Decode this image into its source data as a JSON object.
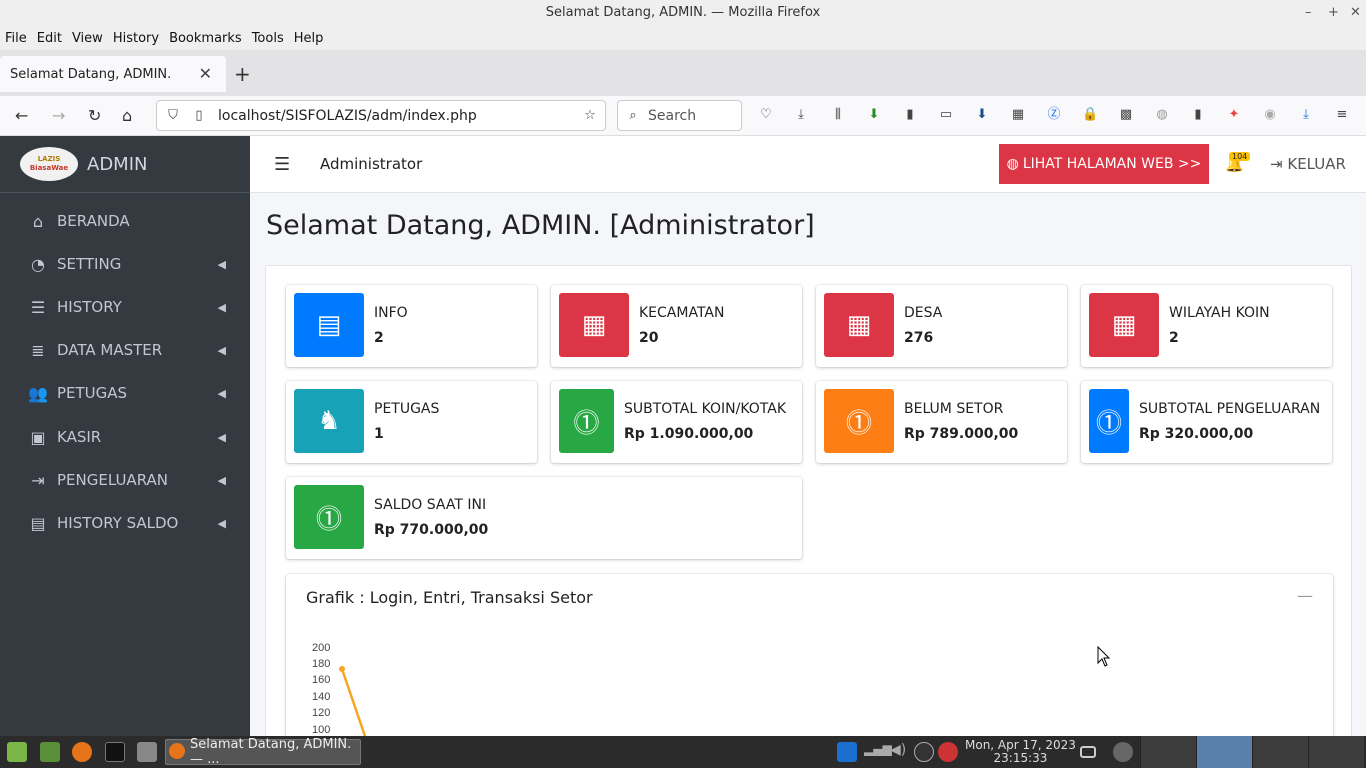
{
  "window": {
    "title": "Selamat Datang, ADMIN. — Mozilla Firefox",
    "controls": [
      "–",
      "+",
      "✕"
    ]
  },
  "menubar": [
    "File",
    "Edit",
    "View",
    "History",
    "Bookmarks",
    "Tools",
    "Help"
  ],
  "browser": {
    "tab_title": "Selamat Datang, ADMIN.",
    "url": "localhost/SISFOLAZIS/adm/index.php",
    "search_placeholder": "Search"
  },
  "sidebar": {
    "brand_logo_line1": "LAZIS",
    "brand_logo_line2": "BiasaWae",
    "brand": "ADMIN",
    "items": [
      {
        "label": "BERANDA",
        "icon": "home-icon",
        "glyph": "⌂",
        "has_arrow": false
      },
      {
        "label": "SETTING",
        "icon": "dashboard-icon",
        "glyph": "◔",
        "has_arrow": true
      },
      {
        "label": "HISTORY",
        "icon": "list-icon",
        "glyph": "☰",
        "has_arrow": true
      },
      {
        "label": "DATA MASTER",
        "icon": "database-icon",
        "glyph": "≣",
        "has_arrow": true
      },
      {
        "label": "PETUGAS",
        "icon": "users-icon",
        "glyph": "👥",
        "has_arrow": true
      },
      {
        "label": "KASIR",
        "icon": "money-icon",
        "glyph": "▣",
        "has_arrow": true
      },
      {
        "label": "PENGELUARAN",
        "icon": "sign-out-icon",
        "glyph": "⇥",
        "has_arrow": true
      },
      {
        "label": "HISTORY SALDO",
        "icon": "briefcase-icon",
        "glyph": "▤",
        "has_arrow": true
      }
    ]
  },
  "header": {
    "admin_label": "Administrator",
    "web_button": "LIHAT HALAMAN WEB >>",
    "notif_count": "104",
    "logout": "KELUAR"
  },
  "page_title": "Selamat Datang, ADMIN. [Administrator]",
  "infoboxes": [
    {
      "label": "INFO",
      "value": "2",
      "color": "#007bff",
      "icon": "newspaper-icon"
    },
    {
      "label": "KECAMATAN",
      "value": "20",
      "color": "#dc3545",
      "icon": "building-icon"
    },
    {
      "label": "DESA",
      "value": "276",
      "color": "#dc3545",
      "icon": "building-icon"
    },
    {
      "label": "WILAYAH KOIN",
      "value": "2",
      "color": "#dc3545",
      "icon": "building-icon"
    },
    {
      "label": "PETUGAS",
      "value": "1",
      "color": "#17a2b8",
      "icon": "user-secret-icon"
    },
    {
      "label": "SUBTOTAL KOIN/KOTAK",
      "value": "Rp 1.090.000,00",
      "color": "#28a745",
      "icon": "money-bill-icon"
    },
    {
      "label": "BELUM SETOR",
      "value": "Rp 789.000,00",
      "color": "#fd7e14",
      "icon": "money-bill-icon"
    },
    {
      "label": "SUBTOTAL PENGELUARAN",
      "value": "Rp 320.000,00",
      "color": "#007bff",
      "icon": "money-bill-icon"
    },
    {
      "label": "SALDO SAAT INI",
      "value": "Rp 770.000,00",
      "color": "#28a745",
      "icon": "money-bill-icon"
    }
  ],
  "chart": {
    "title": "Grafik : Login, Entri, Transaksi Setor",
    "collapse_symbol": "—",
    "y_ticks": [
      "200",
      "180",
      "160",
      "140",
      "120",
      "100"
    ],
    "line_color": "#f5a623"
  },
  "taskbar": {
    "task_label": "Selamat Datang, ADMIN. — ...",
    "clock_date": "Mon, Apr 17, 2023",
    "clock_time": "23:15:33"
  }
}
